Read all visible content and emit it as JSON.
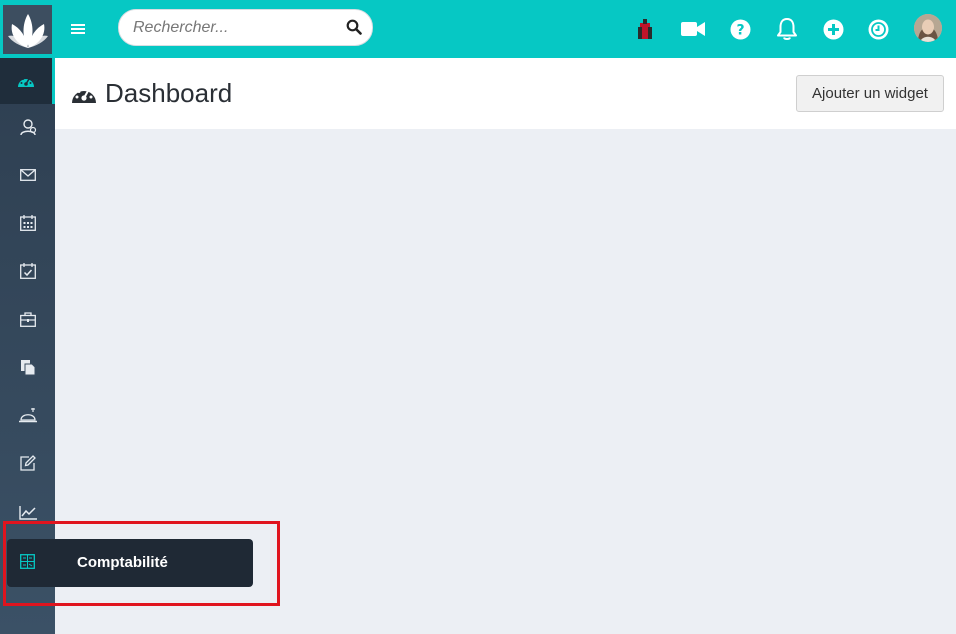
{
  "search": {
    "placeholder": "Rechercher..."
  },
  "header": {
    "title": "Dashboard",
    "add_widget_label": "Ajouter un widget"
  },
  "tooltip": {
    "label": "Comptabilité"
  },
  "icons": {
    "brand": "logo-flower-icon",
    "menu": "hamburger-icon",
    "search": "search-icon",
    "top": [
      "pack-app-icon",
      "video-camera-icon",
      "help-circle-icon",
      "bell-icon",
      "plus-circle-icon",
      "clock-icon"
    ],
    "sidebar": [
      "dashboard-gauge-icon",
      "contacts-icon",
      "mail-icon",
      "calendar-icon",
      "tasks-calendar-icon",
      "briefcase-icon",
      "documents-icon",
      "reception-bell-icon",
      "edit-icon",
      "chart-icon",
      "calculator-icon"
    ]
  },
  "colors": {
    "accent": "#06c8c4",
    "sidebar": "#2e3f51",
    "tooltip": "#1f2935",
    "highlight": "#e0141e"
  }
}
